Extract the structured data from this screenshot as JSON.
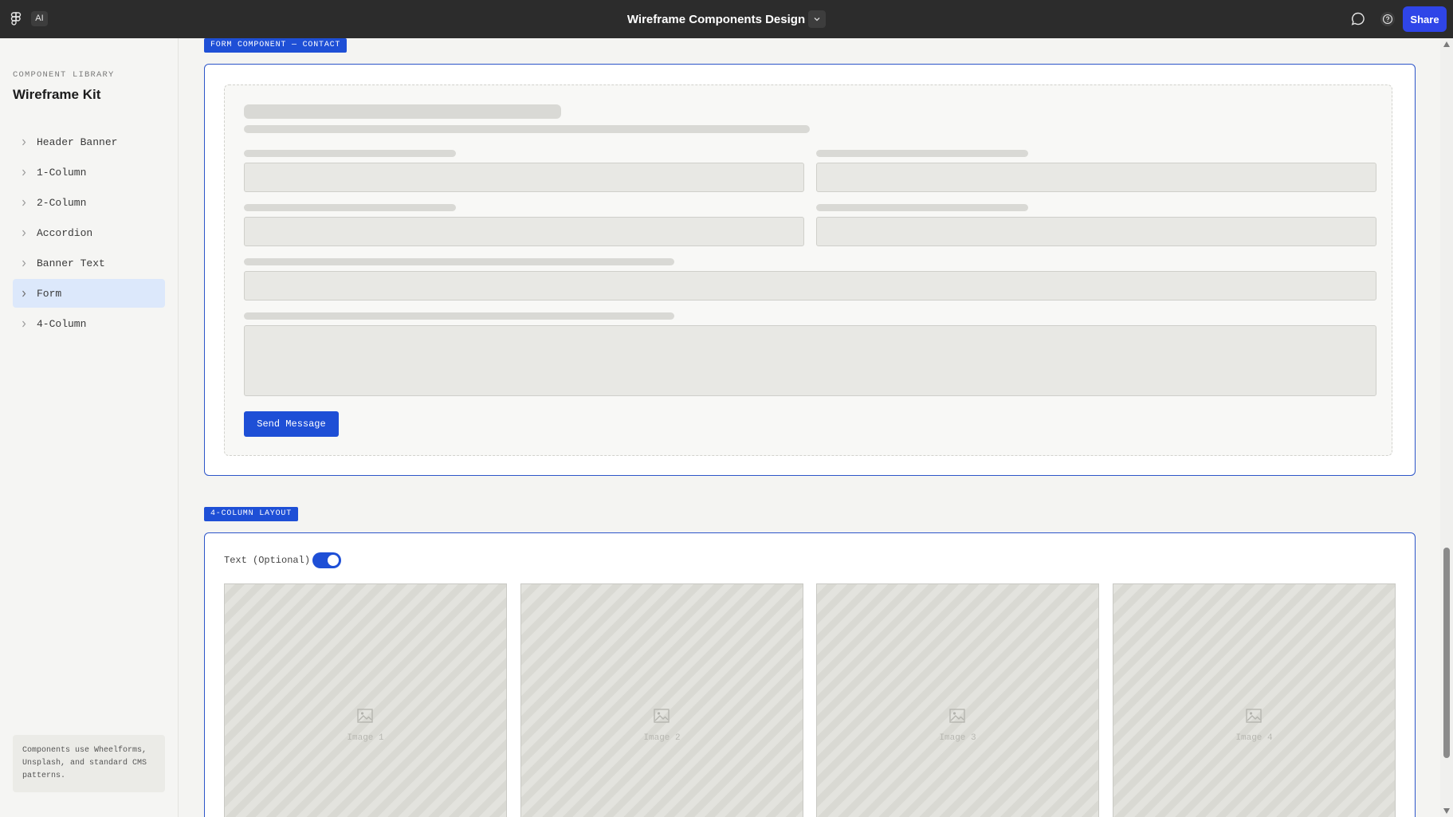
{
  "topbar": {
    "ai_label": "AI",
    "title": "Wireframe Components Design",
    "share_label": "Share"
  },
  "sidebar": {
    "eyebrow": "COMPONENT LIBRARY",
    "title": "Wireframe Kit",
    "items": [
      {
        "label": "Header Banner"
      },
      {
        "label": "1-Column"
      },
      {
        "label": "2-Column"
      },
      {
        "label": "Accordion"
      },
      {
        "label": "Banner Text"
      },
      {
        "label": "Form",
        "active": true
      },
      {
        "label": "4-Column"
      }
    ],
    "note": "Components use Wheelforms, Unsplash, and standard CMS patterns."
  },
  "form_section": {
    "tag": "FORM COMPONENT — CONTACT",
    "send_label": "Send Message"
  },
  "four_col_section": {
    "tag": "4-COLUMN LAYOUT",
    "toggle_label": "Text (Optional)",
    "toggle_on": true,
    "images": [
      "Image 1",
      "Image 2",
      "Image 3",
      "Image 4"
    ]
  },
  "colors": {
    "accent": "#1e4fd6",
    "share": "#2f45e8",
    "topbar": "#2c2c2c",
    "active_item": "#dce8fb"
  }
}
